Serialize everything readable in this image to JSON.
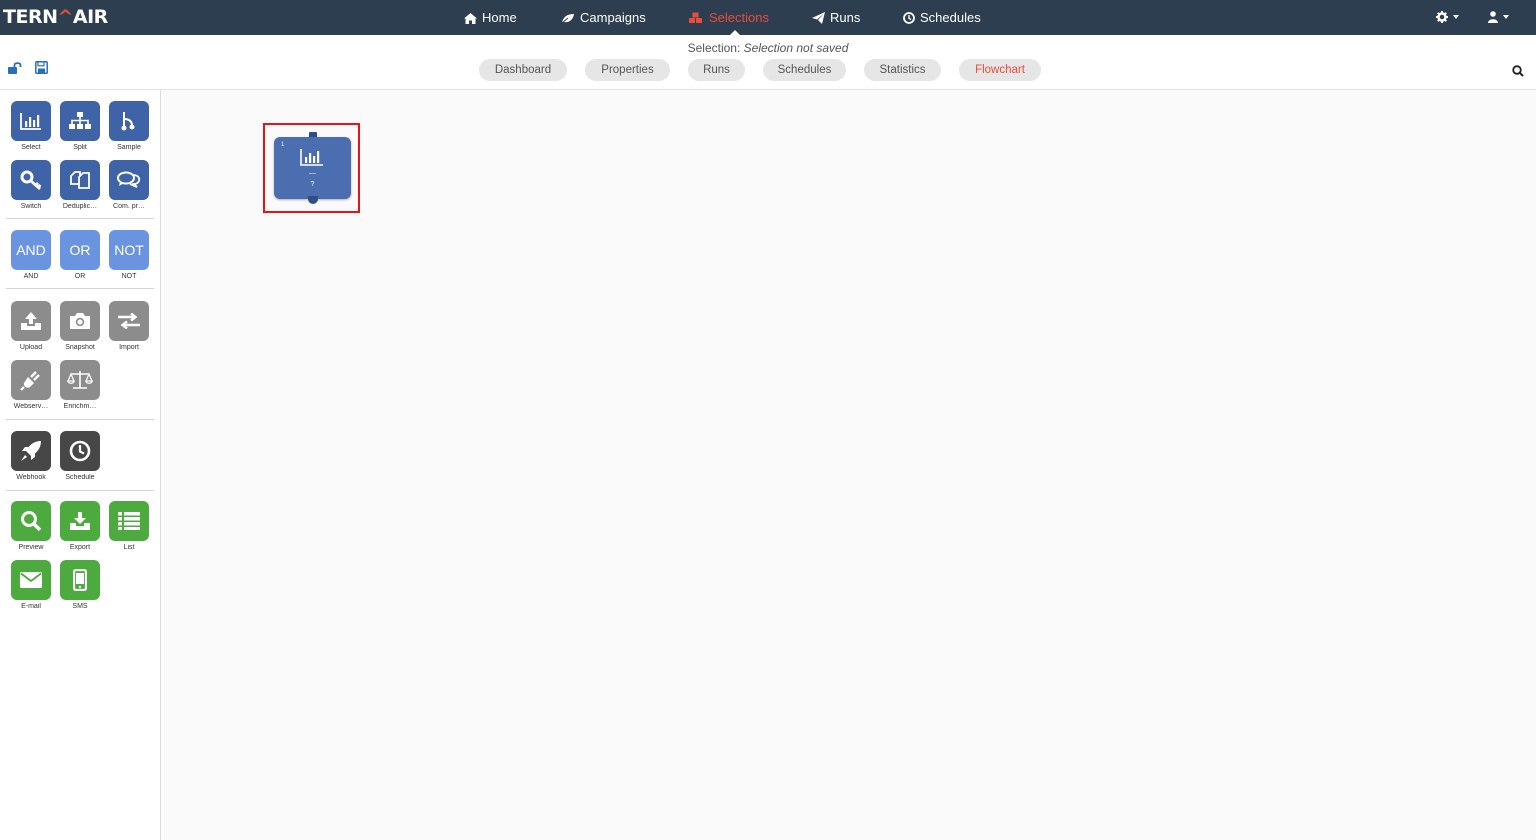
{
  "app": {
    "logo_left": "TERN",
    "logo_accent": "^",
    "logo_right": "AIR"
  },
  "nav": {
    "items": [
      {
        "label": "Home",
        "icon": "home-icon"
      },
      {
        "label": "Campaigns",
        "icon": "leaf-icon"
      },
      {
        "label": "Selections",
        "icon": "cubes-icon",
        "active": true
      },
      {
        "label": "Runs",
        "icon": "paper-plane-icon"
      },
      {
        "label": "Schedules",
        "icon": "clock-icon"
      }
    ],
    "settings_icon": "gear-icon",
    "user_icon": "user-icon",
    "active_color": "#e74c3c",
    "bar_color": "#2c3e50"
  },
  "selection": {
    "prefix": "Selection:",
    "value": "Selection not saved"
  },
  "toolbar": {
    "unlock_icon": "unlock-icon",
    "save_icon": "save-icon",
    "search_icon": "search-icon"
  },
  "tabs": [
    {
      "label": "Dashboard"
    },
    {
      "label": "Properties"
    },
    {
      "label": "Runs"
    },
    {
      "label": "Schedules"
    },
    {
      "label": "Statistics"
    },
    {
      "label": "Flowchart",
      "active": true
    }
  ],
  "sidebar": {
    "groups": [
      {
        "tools": [
          {
            "label": "Select",
            "icon": "bar-chart-icon",
            "color": "#3e63a6"
          },
          {
            "label": "Split",
            "icon": "sitemap-icon",
            "color": "#3e63a6"
          },
          {
            "label": "Sample",
            "icon": "sample-icon",
            "color": "#3e63a6"
          },
          {
            "label": "Switch",
            "icon": "key-icon",
            "color": "#3e63a6"
          },
          {
            "label": "Deduplic…",
            "icon": "copy-icon",
            "color": "#3e63a6"
          },
          {
            "label": "Com. pr…",
            "icon": "comments-icon",
            "color": "#3e63a6"
          }
        ]
      },
      {
        "tools": [
          {
            "label": "AND",
            "text": "AND",
            "color": "#6b94e0"
          },
          {
            "label": "OR",
            "text": "OR",
            "color": "#6b94e0"
          },
          {
            "label": "NOT",
            "text": "NOT",
            "color": "#6b94e0"
          }
        ]
      },
      {
        "tools": [
          {
            "label": "Upload",
            "icon": "upload-icon",
            "color": "#8c8c8c"
          },
          {
            "label": "Snapshot",
            "icon": "camera-icon",
            "color": "#8c8c8c"
          },
          {
            "label": "Import",
            "icon": "exchange-icon",
            "color": "#8c8c8c"
          },
          {
            "label": "Webserv…",
            "icon": "plug-icon",
            "color": "#8c8c8c"
          },
          {
            "label": "Enrichm…",
            "icon": "balance-scale-icon",
            "color": "#8c8c8c"
          }
        ]
      },
      {
        "tools": [
          {
            "label": "Webhook",
            "icon": "rocket-icon",
            "color": "#474747"
          },
          {
            "label": "Schedule",
            "icon": "clock-icon",
            "color": "#474747"
          }
        ]
      },
      {
        "tools": [
          {
            "label": "Preview",
            "icon": "search-icon",
            "color": "#4caa3e"
          },
          {
            "label": "Export",
            "icon": "download-icon",
            "color": "#4caa3e"
          },
          {
            "label": "List",
            "icon": "list-icon",
            "color": "#4caa3e"
          },
          {
            "label": "E-mail",
            "icon": "envelope-icon",
            "color": "#4caa3e"
          },
          {
            "label": "SMS",
            "icon": "mobile-icon",
            "color": "#4caa3e"
          }
        ]
      }
    ]
  },
  "canvas": {
    "node": {
      "number": "1",
      "icon": "bar-chart-icon",
      "dash": "—",
      "question": "?",
      "color": "#4a6eaf"
    },
    "highlight_color": "#e3141c"
  }
}
